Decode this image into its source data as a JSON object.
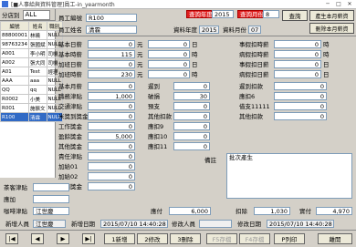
{
  "window": {
    "title": "[■人事給與資料管理]員工-in_yearmonth"
  },
  "left": {
    "dept_label": "分店別",
    "dept_value": "ALL",
    "columns": [
      "編號",
      "姓名",
      "職別"
    ],
    "rows": [
      [
        "88800001",
        "林曉",
        "NULL"
      ],
      [
        "98763234",
        "張國斌",
        "NULL"
      ],
      [
        "A001",
        "李小明",
        "司機"
      ],
      [
        "A002",
        "張大同",
        "司機"
      ],
      [
        "A01",
        "Test",
        "經理"
      ],
      [
        "AAA",
        "aaa",
        "NULL"
      ],
      [
        "QQ",
        "qq",
        "NULL"
      ],
      [
        "R0002",
        "小美",
        "NULL"
      ],
      [
        "R001",
        "施振文",
        "NULL"
      ],
      [
        "R100",
        "清霖",
        "NULL"
      ]
    ],
    "selected_index": 9
  },
  "header": {
    "emp_no_label": "員工編號",
    "emp_no": "R100",
    "emp_name_label": "員工姓名",
    "emp_name": "清霖",
    "year_label": "查詢年度",
    "year": "2015",
    "month_label": "查詢月份",
    "month": "8",
    "query_btn": "查詢",
    "gen_btn": "產生本月薪資",
    "del_btn": "刪除本月薪資",
    "data_year_label": "資料年度",
    "data_year": "2015",
    "data_month_label": "資料月份",
    "data_month": "07"
  },
  "col1": [
    {
      "label": "基本日薪",
      "value": "0",
      "unit": "元"
    },
    {
      "label": "基本時薪",
      "value": "115",
      "unit": "元"
    },
    {
      "label": "加班日薪",
      "value": "0",
      "unit": "元"
    },
    {
      "label": "加班時薪",
      "value": "230",
      "unit": "元"
    },
    {
      "label": "基本月薪",
      "value": "0",
      "unit": ""
    },
    {
      "label": "職務津貼",
      "value": "1,000",
      "unit": ""
    },
    {
      "label": "交通津貼",
      "value": "0",
      "unit": ""
    },
    {
      "label": "米獎到獎金",
      "value": "0",
      "unit": ""
    },
    {
      "label": "工作獎金",
      "value": "0",
      "unit": ""
    },
    {
      "label": "盈餘獎金",
      "value": "5,000",
      "unit": ""
    },
    {
      "label": "其他獎金",
      "value": "0",
      "unit": ""
    },
    {
      "label": "責任津貼",
      "value": "0",
      "unit": ""
    },
    {
      "label": "加給01",
      "value": "0",
      "unit": ""
    },
    {
      "label": "加給02",
      "value": "0",
      "unit": ""
    },
    {
      "label": "業績獎金",
      "value": "0",
      "unit": ""
    }
  ],
  "col2_hours": [
    {
      "value": "0",
      "unit": "日"
    },
    {
      "value": "0",
      "unit": "時"
    },
    {
      "value": "0",
      "unit": "日"
    },
    {
      "value": "0",
      "unit": "時"
    }
  ],
  "col2": [
    {
      "label": "遲到",
      "value": "0"
    },
    {
      "label": "破損",
      "value": "30"
    },
    {
      "label": "預支",
      "value": "0"
    },
    {
      "label": "其他扣款",
      "value": "0"
    },
    {
      "label": "應扣9",
      "value": "0"
    },
    {
      "label": "應扣10",
      "value": "0"
    },
    {
      "label": "應扣11",
      "value": "0"
    }
  ],
  "col3_top": [
    {
      "label": "事假扣時薪",
      "value": "0",
      "unit": "時"
    },
    {
      "label": "病假扣時薪",
      "value": "0",
      "unit": "時"
    },
    {
      "label": "事假扣日薪",
      "value": "0",
      "unit": "日"
    },
    {
      "label": "病假扣日薪",
      "value": "0",
      "unit": "日"
    }
  ],
  "col3": [
    {
      "label": "遲到扣款",
      "value": "0"
    },
    {
      "label": "應扣6",
      "value": "0"
    },
    {
      "label": "借支11111",
      "value": "0"
    },
    {
      "label": "其他扣款",
      "value": "0"
    }
  ],
  "memo": {
    "label": "備註",
    "value": "批次產生"
  },
  "left_lower": [
    {
      "label": "茶客津貼",
      "value": ""
    },
    {
      "label": "應加",
      "value": ""
    },
    {
      "label": "咖啡津貼",
      "value": "江世慶"
    }
  ],
  "totals": {
    "pay_label": "應付",
    "pay": "6,000",
    "deduct_label": "扣除",
    "deduct": "1,030",
    "net_label": "實付",
    "net": "4,970"
  },
  "audit": {
    "add_person_label": "新增人員",
    "add_person": "江世慶",
    "add_date_label": "新增日期",
    "add_date": "2015/07/10 14:40:28",
    "mod_person_label": "修改人員",
    "mod_person": "",
    "mod_date_label": "修改日期",
    "mod_date": "2015/07/10 14:40:28"
  },
  "nav": {
    "new": "1新增",
    "edit": "2修改",
    "delete": "3刪除",
    "save": "F5存檔",
    "cancel": "F4存檔",
    "print": "P列印",
    "exit": "離開"
  }
}
